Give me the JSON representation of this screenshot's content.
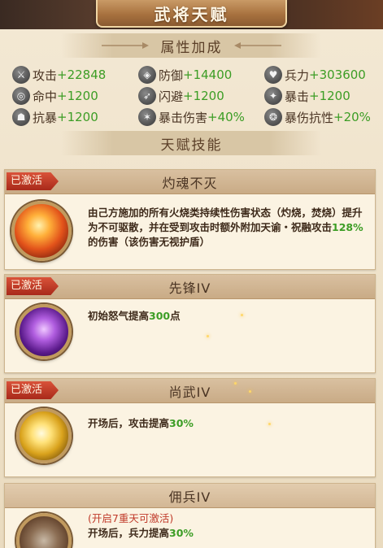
{
  "window_title": "武将天赋",
  "sections": {
    "attributes": "属性加成",
    "skills": "天赋技能"
  },
  "stats": [
    {
      "name": "攻击",
      "value": "+22848",
      "icon": "sword-icon"
    },
    {
      "name": "防御",
      "value": "+14400",
      "icon": "shield-icon"
    },
    {
      "name": "兵力",
      "value": "+303600",
      "icon": "heart-icon"
    },
    {
      "name": "命中",
      "value": "+1200",
      "icon": "target-icon"
    },
    {
      "name": "闪避",
      "value": "+1200",
      "icon": "dodge-icon"
    },
    {
      "name": "暴击",
      "value": "+1200",
      "icon": "crit-icon"
    },
    {
      "name": "抗暴",
      "value": "+1200",
      "icon": "resist-icon"
    },
    {
      "name": "暴击伤害",
      "value": "+40%",
      "icon": "crit-damage-icon"
    },
    {
      "name": "暴伤抗性",
      "value": "+20%",
      "icon": "crit-resist-icon"
    }
  ],
  "skills": [
    {
      "tag": "已激活",
      "name": "灼魂不灭",
      "desc_pre": "由己方施加的所有火烧类持续性伤害状态（灼烧，焚烧）提升为不可驱散，并在受到攻击时额外附加天谕・祝融攻击",
      "desc_hl": "128%",
      "desc_post": "的伤害（该伤害无视护盾）",
      "icon": "fire-emblem-icon"
    },
    {
      "tag": "已激活",
      "name": "先锋IV",
      "desc_pre": "初始怒气提高",
      "desc_hl": "300",
      "desc_post": "点",
      "icon": "rage-emblem-icon"
    },
    {
      "tag": "已激活",
      "name": "尚武IV",
      "desc_pre": "开场后，攻击提高",
      "desc_hl": "30%",
      "desc_post": "",
      "icon": "blade-emblem-icon"
    },
    {
      "name": "佣兵IV",
      "lock_note": "(开启7重天可激活)",
      "desc_pre": "开场后，兵力提高",
      "desc_hl": "30%",
      "desc_post": "",
      "icon": "locked-emblem-icon"
    }
  ],
  "colors": {
    "value_green": "#3c9d25",
    "tag_red": "#c03a2a",
    "panel_bg": "#f3e8d3"
  }
}
